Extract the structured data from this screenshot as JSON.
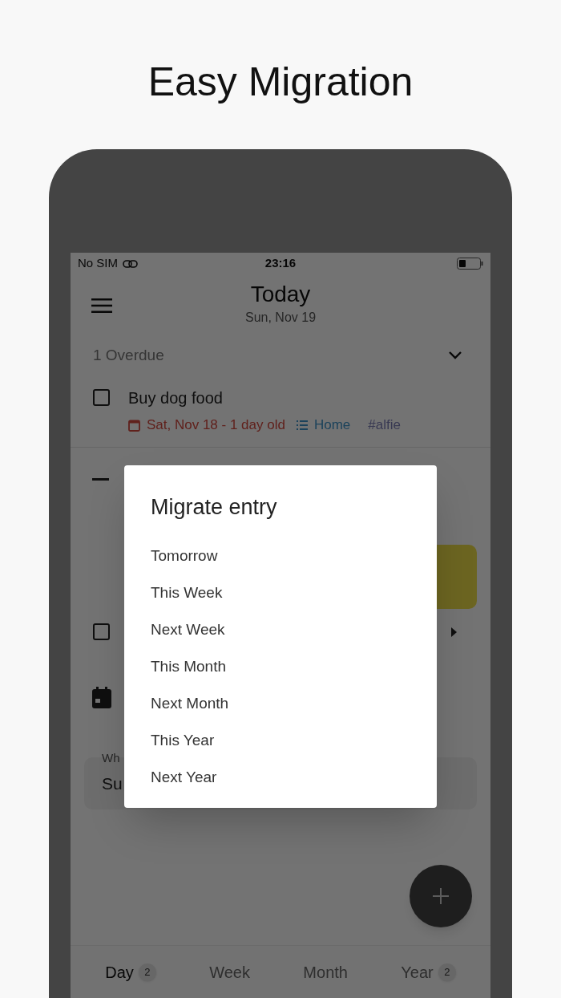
{
  "headline": "Easy Migration",
  "status_bar": {
    "carrier": "No SIM",
    "time": "23:16"
  },
  "header": {
    "title": "Today",
    "subtitle": "Sun, Nov 19"
  },
  "overdue": {
    "label": "1 Overdue",
    "expanded": true
  },
  "overdue_entries": [
    {
      "title": "Buy dog food",
      "checked": false,
      "date": "Sat, Nov 18 - 1 day old",
      "list": "Home",
      "tag": "#alfie"
    }
  ],
  "entries": [
    {
      "kind": "note"
    },
    {
      "kind": "task",
      "checked": false,
      "expanded": false
    },
    {
      "kind": "event"
    }
  ],
  "field": {
    "label": "Wh",
    "value": "Su"
  },
  "dialog": {
    "title": "Migrate entry",
    "options": [
      "Tomorrow",
      "This Week",
      "Next Week",
      "This Month",
      "Next Month",
      "This Year",
      "Next Year"
    ]
  },
  "bottom_nav": [
    {
      "label": "Day",
      "count": "2",
      "selected": true
    },
    {
      "label": "Week",
      "selected": false
    },
    {
      "label": "Month",
      "selected": false
    },
    {
      "label": "Year",
      "count": "2",
      "selected": false
    }
  ]
}
